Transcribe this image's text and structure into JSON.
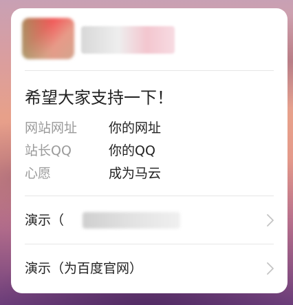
{
  "card": {
    "title": "希望大家支持一下！",
    "info": [
      {
        "label": "网站网址",
        "value": "你的网址"
      },
      {
        "label": "站长QQ",
        "value": "你的QQ"
      },
      {
        "label": "心愿",
        "value": "成为马云"
      }
    ],
    "links": [
      {
        "label": "演示（",
        "icon": "chevron-right-icon"
      },
      {
        "label": "演示（为百度官网）",
        "icon": "chevron-right-icon"
      }
    ]
  },
  "colors": {
    "title_text": "#222222",
    "label_text": "#9a9a9a",
    "divider": "#e6e6e6",
    "chevron": "#c4c4c4"
  }
}
